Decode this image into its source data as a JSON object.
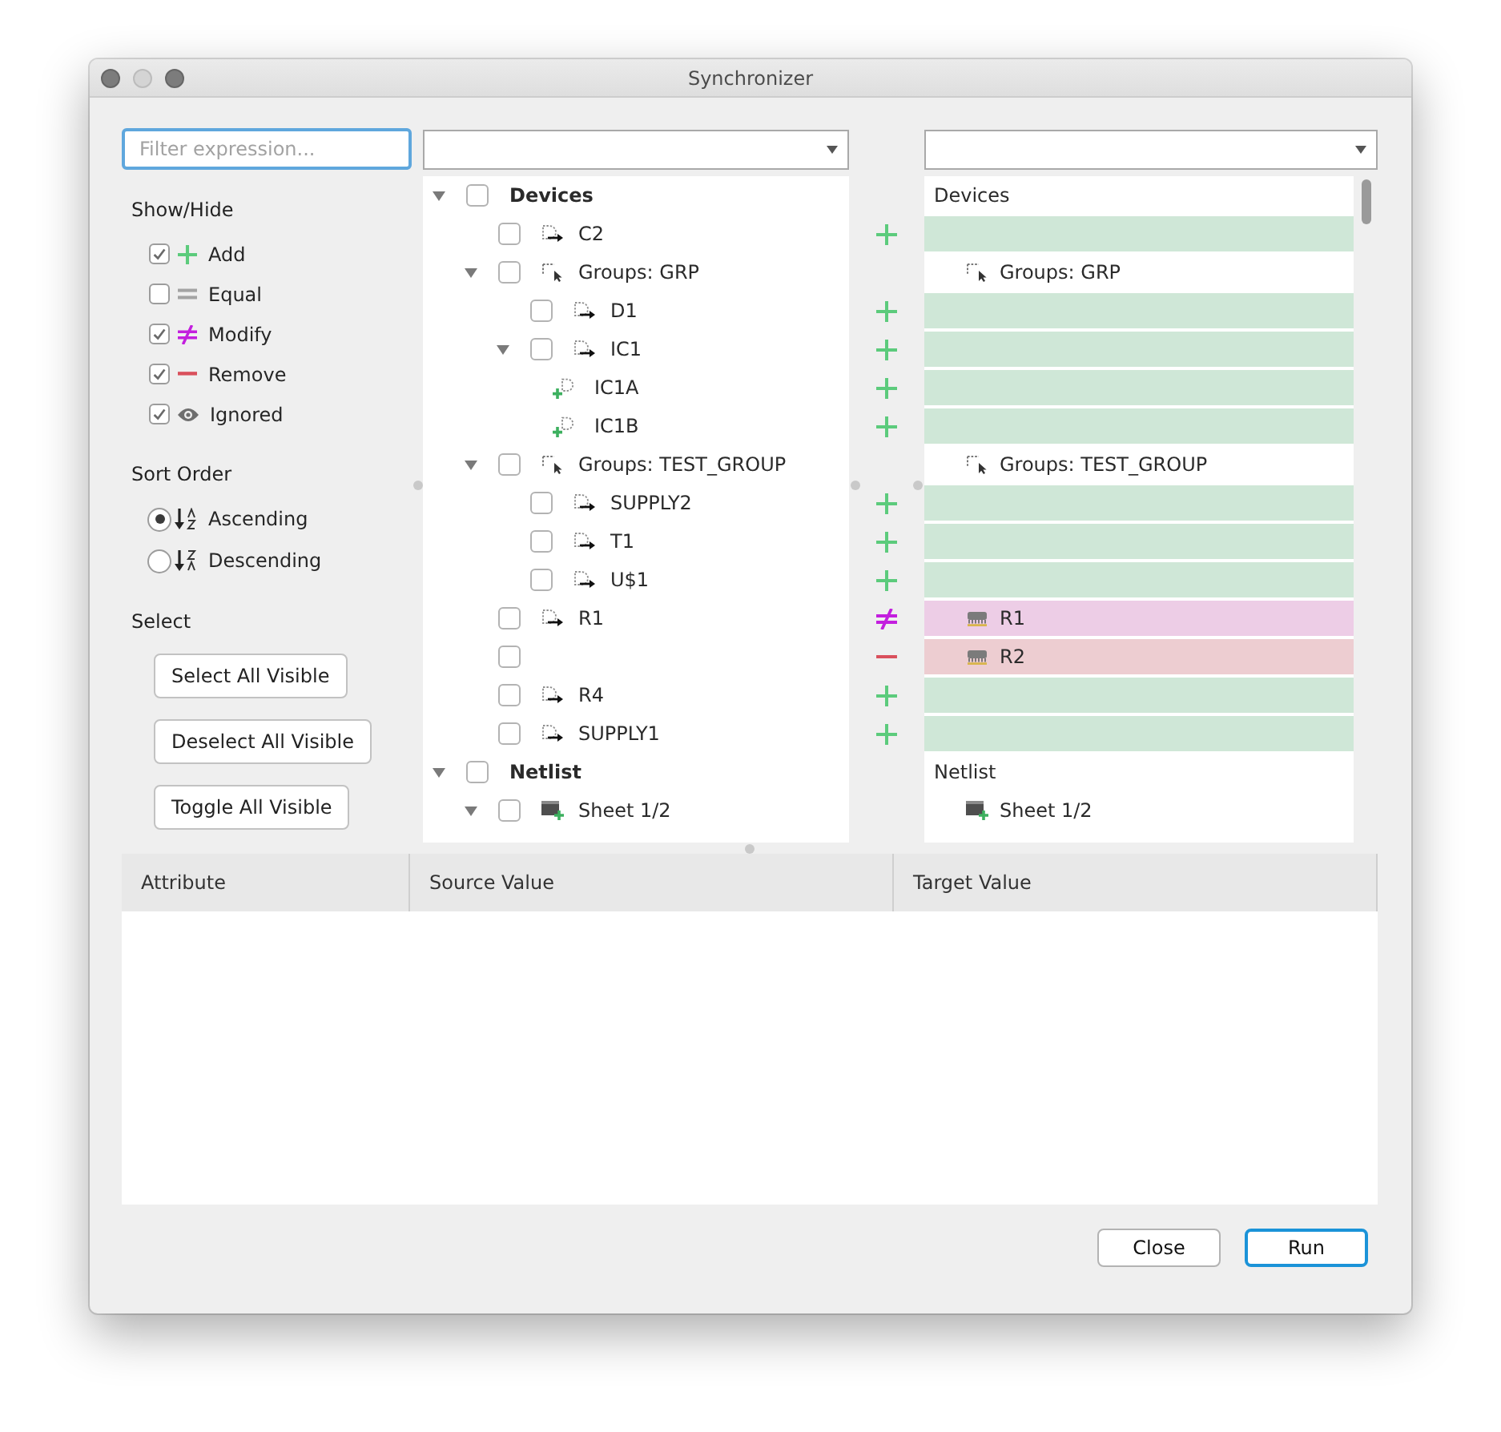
{
  "window": {
    "title": "Synchronizer"
  },
  "filter": {
    "placeholder": "Filter expression..."
  },
  "show_hide": {
    "title": "Show/Hide",
    "items": [
      {
        "kind": "add",
        "label": "Add",
        "checked": true
      },
      {
        "kind": "equal",
        "label": "Equal",
        "checked": false
      },
      {
        "kind": "modify",
        "label": "Modify",
        "checked": true
      },
      {
        "kind": "remove",
        "label": "Remove",
        "checked": true
      },
      {
        "kind": "ignored",
        "label": "Ignored",
        "checked": true
      }
    ]
  },
  "sort_order": {
    "title": "Sort Order",
    "options": [
      {
        "kind": "ascending",
        "label": "Ascending",
        "selected": true
      },
      {
        "kind": "descending",
        "label": "Descending",
        "selected": false
      }
    ]
  },
  "select": {
    "title": "Select",
    "buttons": [
      "Select All Visible",
      "Deselect All Visible",
      "Toggle All Visible"
    ]
  },
  "tree": [
    {
      "label": "Devices",
      "kind": "category",
      "expanded": true,
      "checked": false,
      "target": {
        "label": "Devices",
        "kind": "category"
      },
      "children": [
        {
          "label": "C2",
          "kind": "part",
          "checked": false,
          "diff": {
            "kind": "add"
          }
        },
        {
          "label": "Groups: GRP",
          "kind": "group",
          "expanded": true,
          "checked": false,
          "target": {
            "label": "Groups: GRP",
            "kind": "group"
          },
          "children": [
            {
              "label": "D1",
              "kind": "part",
              "checked": false,
              "diff": {
                "kind": "add"
              }
            },
            {
              "label": "IC1",
              "kind": "part",
              "expanded": true,
              "checked": false,
              "diff": {
                "kind": "add"
              },
              "children": [
                {
                  "label": "IC1A",
                  "kind": "gate",
                  "diff": {
                    "kind": "add"
                  }
                },
                {
                  "label": "IC1B",
                  "kind": "gate",
                  "diff": {
                    "kind": "add"
                  }
                }
              ]
            }
          ]
        },
        {
          "label": "Groups: TEST_GROUP",
          "kind": "group",
          "expanded": true,
          "checked": false,
          "target": {
            "label": "Groups: TEST_GROUP",
            "kind": "group"
          },
          "children": [
            {
              "label": "SUPPLY2",
              "kind": "part",
              "checked": false,
              "diff": {
                "kind": "add"
              }
            },
            {
              "label": "T1",
              "kind": "part",
              "checked": false,
              "diff": {
                "kind": "add"
              }
            },
            {
              "label": "U$1",
              "kind": "part",
              "checked": false,
              "diff": {
                "kind": "add"
              }
            }
          ]
        },
        {
          "label": "R1",
          "kind": "part",
          "checked": false,
          "diff": {
            "kind": "modify"
          },
          "target": {
            "label": "R1",
            "kind": "chip"
          }
        },
        {
          "kind": "absent",
          "checked": false,
          "diff": {
            "kind": "remove"
          },
          "target": {
            "label": "R2",
            "kind": "chip"
          }
        },
        {
          "label": "R4",
          "kind": "part",
          "checked": false,
          "diff": {
            "kind": "add"
          }
        },
        {
          "label": "SUPPLY1",
          "kind": "part",
          "checked": false,
          "diff": {
            "kind": "add"
          }
        }
      ]
    },
    {
      "label": "Netlist",
      "kind": "category",
      "expanded": true,
      "checked": false,
      "target": {
        "label": "Netlist",
        "kind": "category"
      },
      "children": [
        {
          "label": "Sheet 1/2",
          "kind": "sheet",
          "expanded": true,
          "checked": false,
          "target": {
            "label": "Sheet 1/2",
            "kind": "sheet"
          }
        }
      ]
    }
  ],
  "attribute_table": {
    "columns": [
      "Attribute",
      "Source Value",
      "Target Value"
    ]
  },
  "buttons": [
    {
      "label": "Close",
      "default": false
    },
    {
      "label": "Run",
      "default": true
    }
  ]
}
